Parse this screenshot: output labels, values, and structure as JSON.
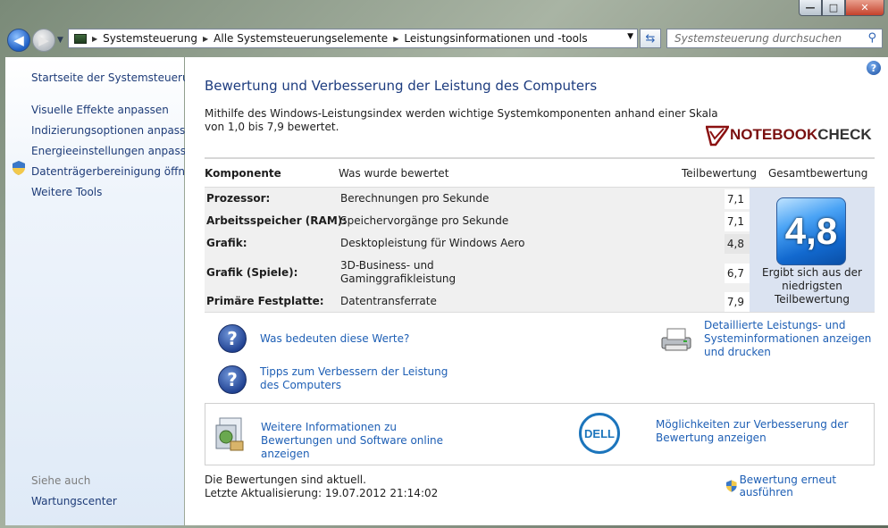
{
  "window": {
    "buttons": {
      "minimize": "—",
      "maximize": "□",
      "close": "✕"
    }
  },
  "address_bar": {
    "breadcrumbs": [
      "Systemsteuerung",
      "Alle Systemsteuerungselemente",
      "Leistungsinformationen und -tools"
    ],
    "search_placeholder": "Systemsteuerung durchsuchen"
  },
  "sidebar": {
    "home": "Startseite der Systemsteuerung",
    "items": [
      "Visuelle Effekte anpassen",
      "Indizierungsoptionen anpassen",
      "Energieeinstellungen anpassen",
      "Datenträgerbereinigung öffnen",
      "Weitere Tools"
    ],
    "see_also_heading": "Siehe auch",
    "see_also_items": [
      "Wartungscenter"
    ]
  },
  "main": {
    "help_label": "?",
    "title": "Bewertung und Verbesserung der Leistung des Computers",
    "description": "Mithilfe des Windows-Leistungsindex werden wichtige Systemkomponenten anhand einer Skala von 1,0 bis 7,9 bewertet.",
    "logo_text": {
      "part1": "NOTEBOOK",
      "part2": "CHECK"
    },
    "table": {
      "headers": {
        "component": "Komponente",
        "rated": "Was wurde bewertet",
        "subscore": "Teilbewertung",
        "base": "Gesamtbewertung"
      },
      "rows": [
        {
          "component": "Prozessor:",
          "rated": "Berechnungen pro Sekunde",
          "score": "7,1"
        },
        {
          "component": "Arbeitsspeicher (RAM):",
          "rated": "Speichervorgänge pro Sekunde",
          "score": "7,1"
        },
        {
          "component": "Grafik:",
          "rated": "Desktopleistung für Windows Aero",
          "score": "4,8"
        },
        {
          "component": "Grafik (Spiele):",
          "rated": "3D-Business- und Gaminggrafikleistung",
          "score": "6,7"
        },
        {
          "component": "Primäre Festplatte:",
          "rated": "Datentransferrate",
          "score": "7,9"
        }
      ],
      "base_score": "4,8",
      "base_note": "Ergibt sich aus der niedrigsten Teilbewertung"
    },
    "links": {
      "what_values": "Was bedeuten diese Werte?",
      "tips": "Tipps zum Verbessern der Leistung des Computers",
      "detailed": "Detaillierte Leistungs- und Systeminformationen anzeigen und drucken",
      "more_info": "Weitere Informationen zu Bewertungen und Software online anzeigen",
      "improve_options": "Möglichkeiten zur Verbesserung der Bewertung anzeigen"
    },
    "vendor_logo": "DELL",
    "status": {
      "current": "Die Bewertungen sind aktuell.",
      "last_update": "Letzte Aktualisierung: 19.07.2012 21:14:02"
    },
    "rerun": "Bewertung erneut ausführen"
  }
}
